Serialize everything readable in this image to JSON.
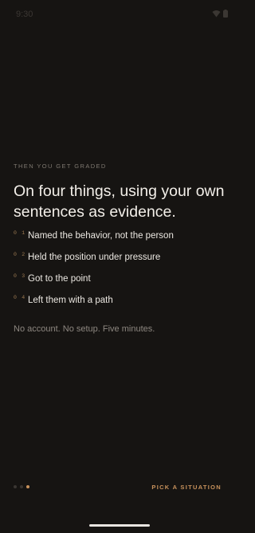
{
  "status_bar": {
    "time": "9:30",
    "icons": [
      "wifi-icon",
      "battery-icon"
    ]
  },
  "onboarding": {
    "eyebrow": "THEN YOU GET GRADED",
    "headline": "On four things, using your own sentences as evidence.",
    "criteria": [
      {
        "number": "01",
        "label": "Named the behavior, not the person"
      },
      {
        "number": "02",
        "label": "Held the position under pressure"
      },
      {
        "number": "03",
        "label": "Got to the point"
      },
      {
        "number": "04",
        "label": "Left them with a path"
      }
    ],
    "note": "No account. No setup. Five minutes."
  },
  "footer": {
    "pager": {
      "total": 3,
      "active_index": 2
    },
    "cta_label": "PICK A SITUATION"
  },
  "colors": {
    "background": "#161412",
    "accent": "#c8925c",
    "text_primary": "#f3efe9",
    "text_muted": "#8d8780"
  }
}
